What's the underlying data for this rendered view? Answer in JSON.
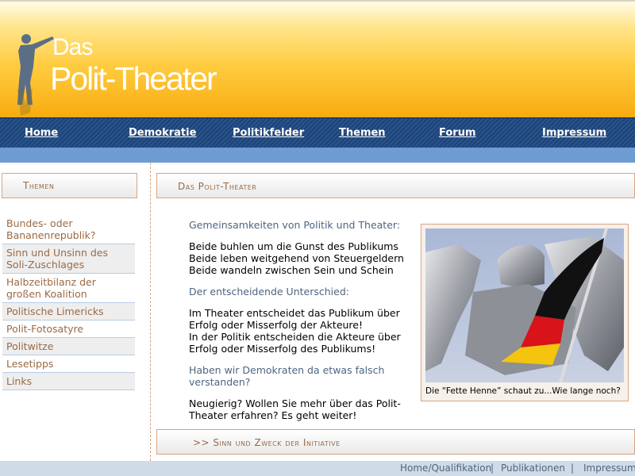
{
  "header": {
    "logo_top": "Das",
    "logo_main": "Polit-Theater"
  },
  "nav": {
    "items": [
      "Home",
      "Demokratie",
      "Politikfelder",
      "Themen",
      "Forum",
      "Impressum"
    ]
  },
  "sidebar": {
    "title": "Themen",
    "items": [
      "Bundes- oder Bananenrepublik?",
      "Sinn und Unsinn des Soli-Zuschlages",
      "Halbzeitbilanz der großen Koalition",
      "Politische Limericks",
      "Polit-Fotosatyre",
      "Politwitze",
      "Lesetipps",
      "Links"
    ]
  },
  "main": {
    "title": "Das Polit-Theater",
    "intro": "Gemeinsamkeiten von Politik und Theater:",
    "list": [
      "Beide buhlen um die Gunst des Publikums",
      "Beide leben weitgehend von Steuergeldern",
      "Beide wandeln zwischen Sein und Schein"
    ],
    "difference_heading": "Der entscheidende Unterschied:",
    "difference_lines": [
      "Im Theater entscheidet das Publikum über Erfolg oder Misserfolg der Akteure!",
      "In der Politik entscheiden die Akteure über Erfolg oder Misserfolg des Publikums!"
    ],
    "question": "Haben wir Demokraten da etwas falsch verstanden?",
    "closing": "Neugierig? Wollen Sie mehr über das Polit-Theater erfahren? Es geht weiter!",
    "photo_caption": "Die “Fette Henne” schaut zu...Wie lange noch?",
    "bottom_link": ">> Sinn und Zweck der Initiative"
  },
  "footer": {
    "links": [
      "Home/Qualifikation",
      "Publikationen",
      "Impressum"
    ],
    "separator": "|"
  }
}
